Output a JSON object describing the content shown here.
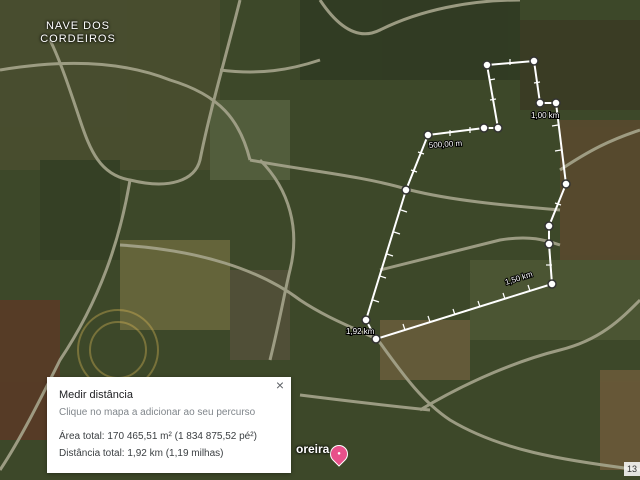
{
  "map": {
    "place_label_line1": "NAVE DOS",
    "place_label_line2": "CORDEIROS",
    "poi_label": "oreira",
    "poi_icon": "shopping-pin-icon",
    "scale_corner": "13",
    "colors": {
      "measure_line": "#ffffff",
      "pin": "#e8508a",
      "terrain_dark": "#2f3a22",
      "terrain_field": "#6e6240"
    }
  },
  "measure": {
    "labels": {
      "m500": "500,00 m",
      "km100": "1,00 km",
      "km150": "1,50 km",
      "km192": "1,92 km"
    }
  },
  "panel": {
    "title": "Medir distância",
    "hint": "Clique no mapa a adicionar ao seu percurso",
    "area": "Área total: 170 465,51 m² (1 834 875,52 pé²)",
    "distance": "Distância total: 1,92 km (1,19 milhas)",
    "close_glyph": "×"
  }
}
